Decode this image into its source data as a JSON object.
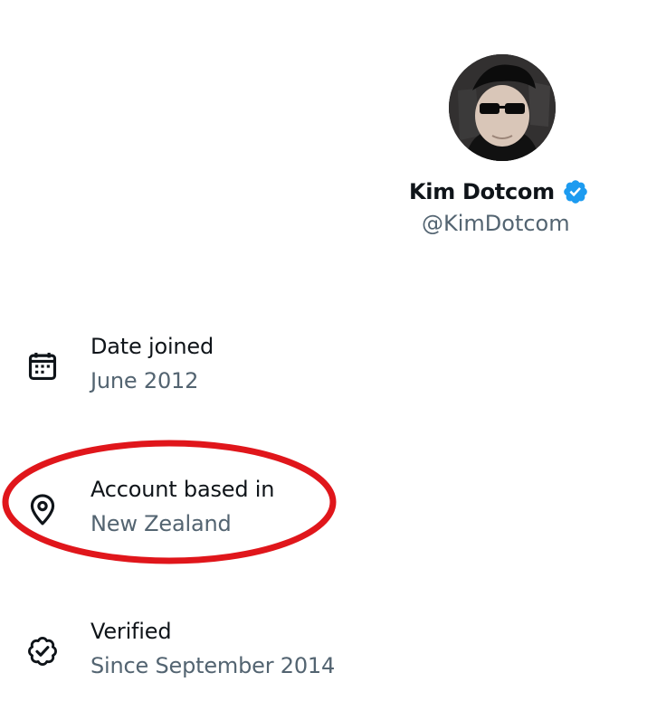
{
  "profile": {
    "display_name": "Kim Dotcom",
    "handle": "@KimDotcom",
    "verified_badge_color": "#1d9bf0"
  },
  "about": {
    "items": [
      {
        "icon": "calendar-icon",
        "title": "Date joined",
        "value": "June 2012"
      },
      {
        "icon": "location-pin-icon",
        "title": "Account based in",
        "value": "New Zealand"
      },
      {
        "icon": "verified-icon",
        "title": "Verified",
        "value": "Since September 2014"
      }
    ]
  },
  "annotation": {
    "highlight_color": "#e0161b",
    "highlights_item": "Account based in"
  }
}
